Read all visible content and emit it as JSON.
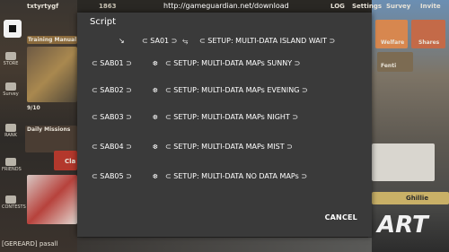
{
  "url_bar": "http://gameguardian.net/download",
  "background": {
    "player_name": "txtyrtygf",
    "coins": "1863",
    "menu_labels": [
      "LOG",
      "Settings",
      "Survey",
      "Invite"
    ],
    "left_panel": [
      "Training Manual",
      "STORE",
      "Survey",
      "9/10",
      "RANK",
      "Daily Missions",
      "Cla",
      "FRIENDS",
      "CONTESTS"
    ],
    "right_panel": [
      "Welfare",
      "Shares",
      "Fenti",
      "Ghillie",
      "ART"
    ],
    "bottom_chat": "[GEREARD] pasall"
  },
  "dialog": {
    "title": "Script",
    "header": {
      "arrow_icon": "↘",
      "sa_label": "⊂ SA01 ⊃",
      "link_icon": "⥃",
      "setup_label": "⊂ SETUP: MULTI-DATA ISLAND WAIT ⊃"
    },
    "items": [
      {
        "code": "⊂ SAB01 ⊃",
        "icon": "❆",
        "setup": "⊂ SETUP: MULTI-DATA MAPs SUNNY ⊃"
      },
      {
        "code": "⊂ SAB02 ⊃",
        "icon": "❆",
        "setup": "⊂ SETUP: MULTI-DATA MAPs EVENING ⊃"
      },
      {
        "code": "⊂ SAB03 ⊃",
        "icon": "❆",
        "setup": "⊂ SETUP: MULTI-DATA MAPs NIGHT ⊃"
      },
      {
        "code": "⊂ SAB04 ⊃",
        "icon": "❆",
        "setup": "⊂ SETUP: MULTI-DATA MAPs MIST ⊃"
      },
      {
        "code": "⊂ SAB05 ⊃",
        "icon": "❆",
        "setup": "⊂ SETUP: MULTI-DATA NO DATA MAPs ⊃"
      }
    ],
    "cancel_label": "CANCEL"
  }
}
